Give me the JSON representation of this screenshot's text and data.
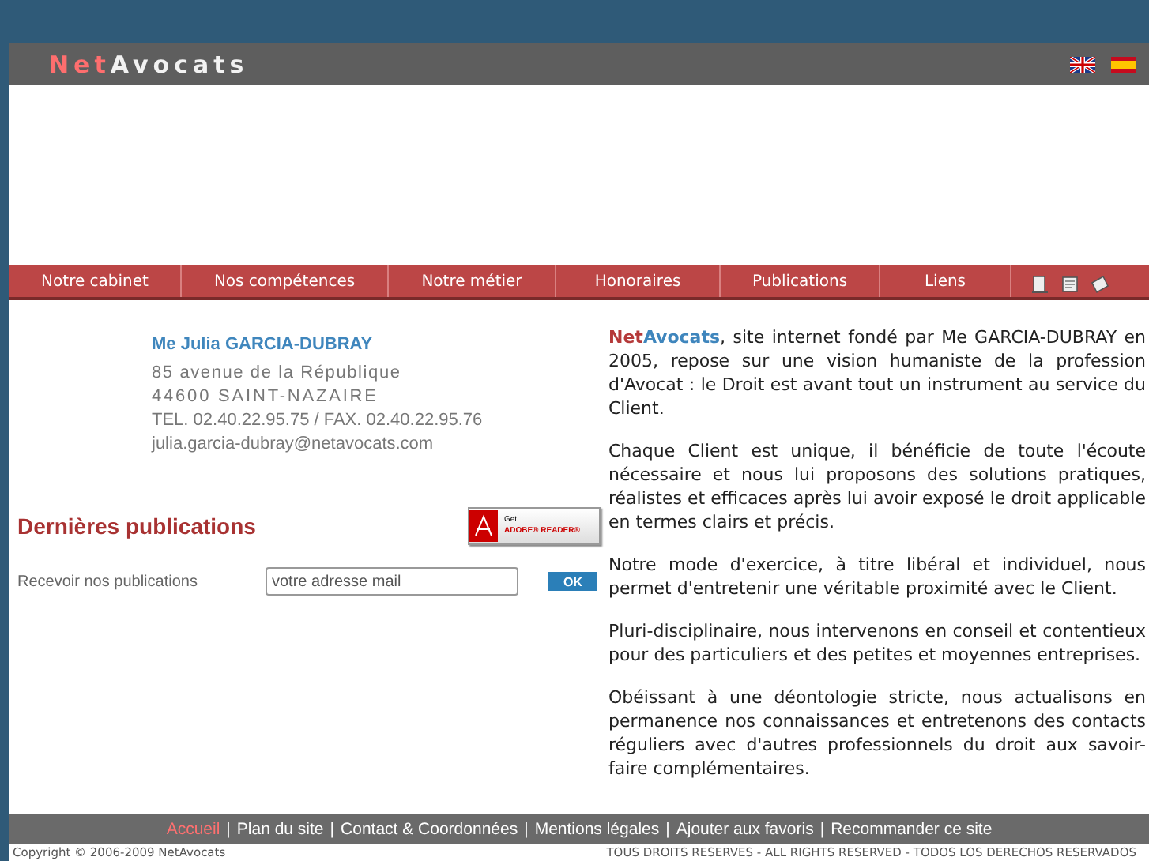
{
  "header": {
    "logo_first": "Net",
    "logo_second": "Avocats",
    "languages": [
      {
        "kind": "uk"
      },
      {
        "kind": "es"
      }
    ]
  },
  "nav": {
    "items": [
      "Notre cabinet",
      "Nos compétences",
      "Notre métier",
      "Honoraires",
      "Publications",
      "Liens"
    ],
    "tools": [
      {
        "kind": "print"
      },
      {
        "kind": "page"
      },
      {
        "kind": "mail"
      }
    ]
  },
  "contact": {
    "name": "Me Julia GARCIA-DUBRAY",
    "address": "85 avenue de la République",
    "city": "44600 SAINT-NAZAIRE",
    "phone": "TEL. 02.40.22.95.75 / FAX. 02.40.22.95.76",
    "email": "julia.garcia-dubray@netavocats.com"
  },
  "publications": {
    "title": "Dernières publications",
    "reader_badge": {
      "line_1": "Get",
      "line_2": "ADOBE® READER®"
    },
    "subscribe_label": "Recevoir nos publications",
    "placeholder": "votre adresse mail",
    "button": "OK"
  },
  "intro": {
    "brand_first": "Net",
    "brand_second": "Avocats",
    "text": ", site internet fondé par Me GARCIA-DUBRAY en 2005, repose sur une vision humaniste de la profession d'Avocat : le Droit est avant tout un instrument  au service du  Client."
  },
  "paragraphs": [
    "Chaque Client est unique, il bénéficie de toute l'écoute nécessaire et nous lui proposons des solutions pratiques, réalistes et efficaces après lui avoir exposé le droit applicable en termes clairs et précis.",
    "Notre mode d'exercice, à titre libéral et individuel, nous permet d'entretenir une véritable proximité avec le Client.",
    "Pluri-disciplinaire, nous intervenons en conseil et contentieux pour des particuliers et des petites et moyennes entreprises.",
    "Obéissant à une déontologie stricte, nous actualisons en permanence nos connaissances et entretenons des contacts réguliers avec d'autres professionnels du droit aux savoir-faire complémentaires."
  ],
  "footer": {
    "separator": "|",
    "links": [
      {
        "label": "Accueil",
        "selected": true
      },
      {
        "label": "Plan du site",
        "selected": false
      },
      {
        "label": "Contact & Coordonnées",
        "selected": false
      },
      {
        "label": "Mentions légales",
        "selected": false
      },
      {
        "label": "Ajouter aux favoris",
        "selected": false
      },
      {
        "label": "Recommander ce site",
        "selected": false
      }
    ],
    "copyright": "Copyright © 2006-2009 NetAvocats",
    "rights": "TOUS DROITS RESERVES - ALL RIGHTS RESERVED - TODOS LOS DERECHOS RESERVADOS"
  }
}
